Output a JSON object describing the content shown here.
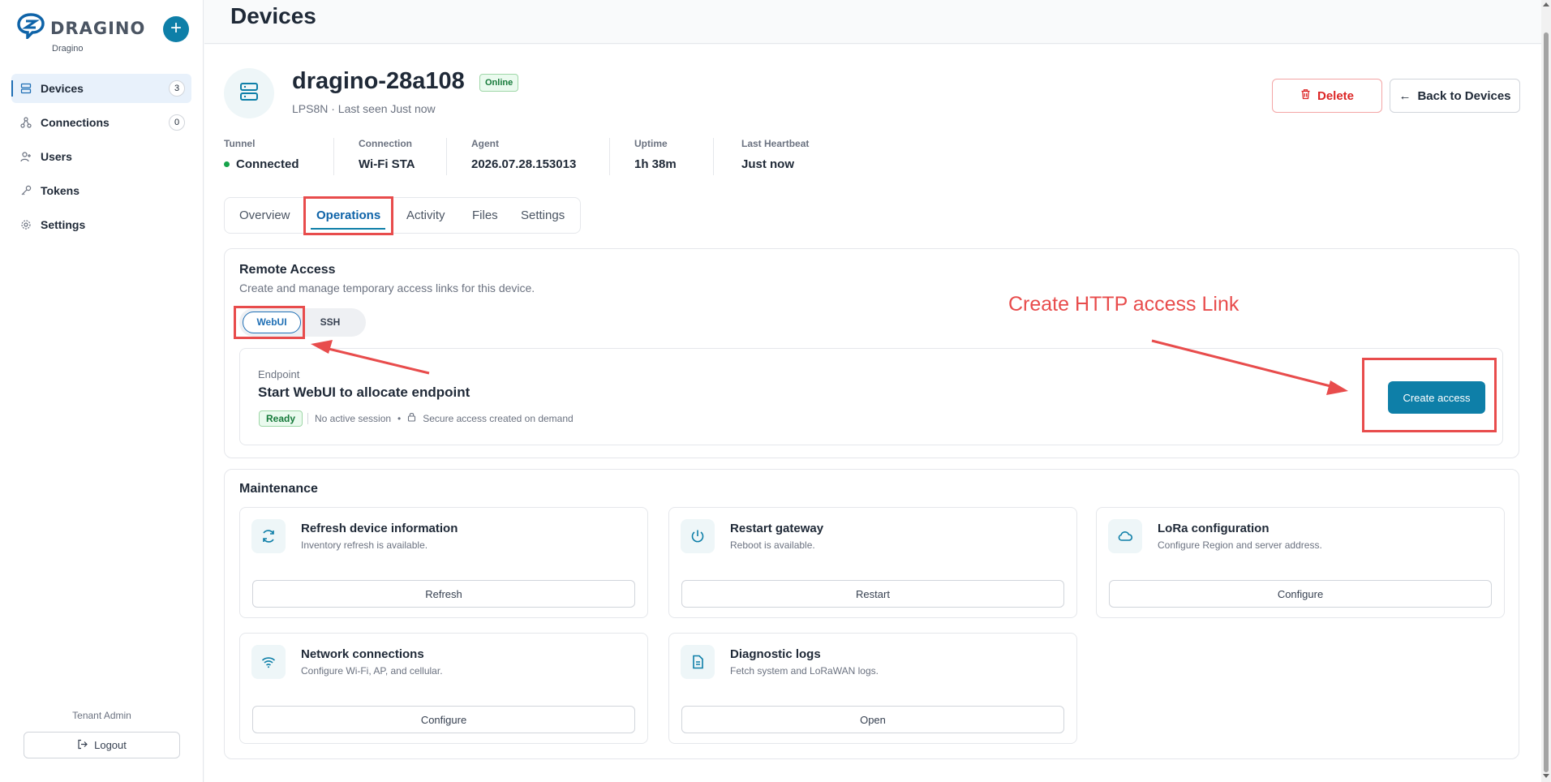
{
  "brand": {
    "name": "DRAGINO",
    "tenant_name": "Dragino",
    "add_label": "+"
  },
  "sidebar": {
    "items": [
      {
        "label": "Devices",
        "count": "3",
        "icon": "server-icon"
      },
      {
        "label": "Connections",
        "count": "0",
        "icon": "network-icon"
      },
      {
        "label": "Users",
        "icon": "user-plus-icon"
      },
      {
        "label": "Tokens",
        "icon": "key-icon"
      },
      {
        "label": "Settings",
        "icon": "gear-icon"
      }
    ],
    "role": "Tenant Admin",
    "logout_label": "Logout"
  },
  "header": {
    "title": "Devices"
  },
  "device": {
    "name": "dragino-28a108",
    "status": "Online",
    "subtitle": "LPS8N · Last seen Just now",
    "delete_label": "Delete",
    "back_label": "Back to Devices",
    "back_arrow": "←"
  },
  "stats": [
    {
      "label": "Tunnel",
      "value": "Connected"
    },
    {
      "label": "Connection",
      "value": "Wi-Fi STA"
    },
    {
      "label": "Agent",
      "value": "2026.07.28.153013"
    },
    {
      "label": "Uptime",
      "value": "1h 38m"
    },
    {
      "label": "Last Heartbeat",
      "value": "Just now"
    }
  ],
  "tabs": [
    {
      "label": "Overview"
    },
    {
      "label": "Operations",
      "active": true
    },
    {
      "label": "Activity"
    },
    {
      "label": "Files"
    },
    {
      "label": "Settings"
    }
  ],
  "remote_access": {
    "title": "Remote Access",
    "description": "Create and manage temporary access links for this device.",
    "modes": [
      "WebUI",
      "SSH"
    ],
    "selected_mode": "WebUI",
    "endpoint_label": "Endpoint",
    "endpoint_title": "Start WebUI to allocate endpoint",
    "ready_label": "Ready",
    "session_text": "No active session",
    "bullet": "•",
    "secure_text": "Secure access created on demand",
    "create_label": "Create access"
  },
  "maintenance": {
    "title": "Maintenance",
    "cards": [
      {
        "title": "Refresh device information",
        "desc": "Inventory refresh is available.",
        "button": "Refresh",
        "icon": "refresh-icon"
      },
      {
        "title": "Restart gateway",
        "desc": "Reboot is available.",
        "button": "Restart",
        "icon": "power-icon"
      },
      {
        "title": "LoRa configuration",
        "desc": "Configure Region and server address.",
        "button": "Configure",
        "icon": "cloud-icon"
      },
      {
        "title": "Network connections",
        "desc": "Configure Wi-Fi, AP, and cellular.",
        "button": "Configure",
        "icon": "wifi-icon"
      },
      {
        "title": "Diagnostic logs",
        "desc": "Fetch system and LoRaWAN logs.",
        "button": "Open",
        "icon": "file-text-icon"
      }
    ]
  },
  "annotation": {
    "text": "Create HTTP access Link",
    "color": "#e84c4c"
  },
  "colors": {
    "accent": "#0e7fa8",
    "danger": "#dc2626",
    "success": "#16a34a"
  }
}
